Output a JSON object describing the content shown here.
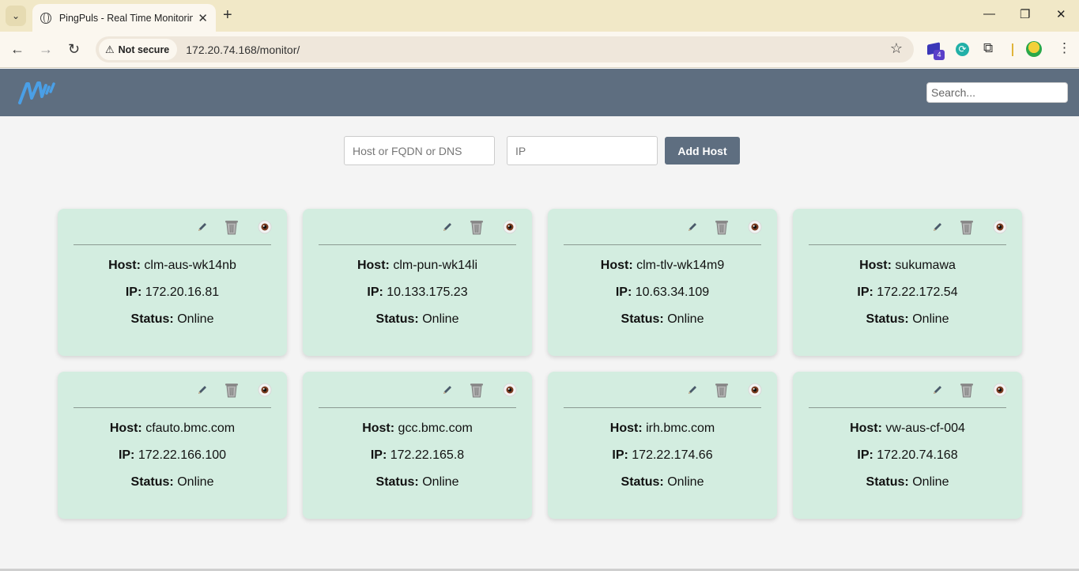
{
  "browser": {
    "tab_title": "PingPuls - Real Time Monitoring",
    "security_label": "Not secure",
    "url": "172.20.74.168/monitor/",
    "extension_badge": "4"
  },
  "header": {
    "search_placeholder": "Search..."
  },
  "form": {
    "host_placeholder": "Host or FQDN or DNS",
    "ip_placeholder": "IP",
    "add_label": "Add Host"
  },
  "labels": {
    "host": "Host:",
    "ip": "IP:",
    "status": "Status:"
  },
  "hosts": [
    {
      "host": "clm-aus-wk14nb",
      "ip": "172.20.16.81",
      "status": "Online"
    },
    {
      "host": "clm-pun-wk14li",
      "ip": "10.133.175.23",
      "status": "Online"
    },
    {
      "host": "clm-tlv-wk14m9",
      "ip": "10.63.34.109",
      "status": "Online"
    },
    {
      "host": "sukumawa",
      "ip": "172.22.172.54",
      "status": "Online"
    },
    {
      "host": "cfauto.bmc.com",
      "ip": "172.22.166.100",
      "status": "Online"
    },
    {
      "host": "gcc.bmc.com",
      "ip": "172.22.165.8",
      "status": "Online"
    },
    {
      "host": "irh.bmc.com",
      "ip": "172.22.174.66",
      "status": "Online"
    },
    {
      "host": "vw-aus-cf-004",
      "ip": "172.20.74.168",
      "status": "Online"
    }
  ],
  "colors": {
    "header_bg": "#5e6e80",
    "card_bg": "#d3ede0",
    "logo": "#4a9fe6"
  }
}
